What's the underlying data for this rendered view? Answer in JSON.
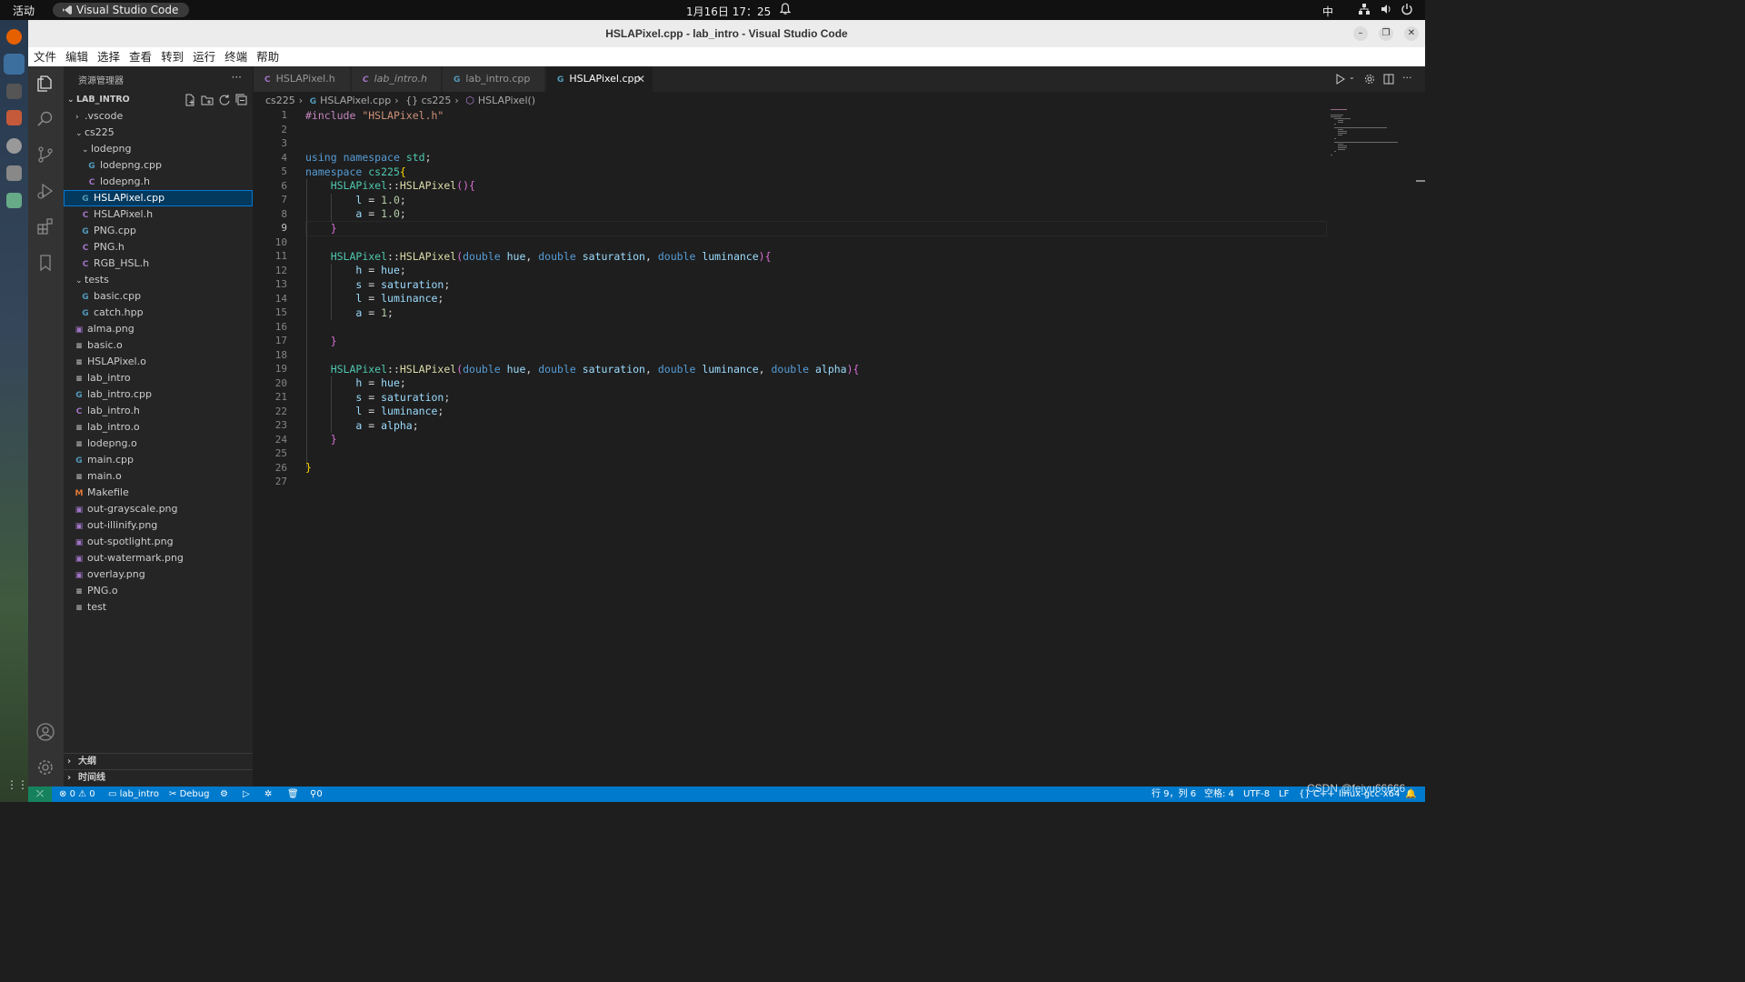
{
  "system": {
    "activities": "活动",
    "app_name": "Visual Studio Code",
    "clock": "1月16日 17：25",
    "input_method": "中"
  },
  "window": {
    "title": "HSLAPixel.cpp - lab_intro - Visual Studio Code"
  },
  "menu": [
    "文件",
    "编辑",
    "选择",
    "查看",
    "转到",
    "运行",
    "终端",
    "帮助"
  ],
  "sidebar": {
    "header": "资源管理器",
    "more": "···",
    "root": "LAB_INTRO",
    "tree": [
      {
        "label": ".vscode",
        "kind": "folder",
        "open": false,
        "depth": 1
      },
      {
        "label": "cs225",
        "kind": "folder",
        "open": true,
        "depth": 1
      },
      {
        "label": "lodepng",
        "kind": "folder",
        "open": true,
        "depth": 2
      },
      {
        "label": "lodepng.cpp",
        "kind": "cpp",
        "depth": 3
      },
      {
        "label": "lodepng.h",
        "kind": "h",
        "depth": 3
      },
      {
        "label": "HSLAPixel.cpp",
        "kind": "cpp",
        "depth": 2,
        "selected": true
      },
      {
        "label": "HSLAPixel.h",
        "kind": "h",
        "depth": 2
      },
      {
        "label": "PNG.cpp",
        "kind": "cpp",
        "depth": 2
      },
      {
        "label": "PNG.h",
        "kind": "h",
        "depth": 2
      },
      {
        "label": "RGB_HSL.h",
        "kind": "h",
        "depth": 2
      },
      {
        "label": "tests",
        "kind": "folder",
        "open": true,
        "depth": 1
      },
      {
        "label": "basic.cpp",
        "kind": "cpp",
        "depth": 2
      },
      {
        "label": "catch.hpp",
        "kind": "cpp",
        "depth": 2
      },
      {
        "label": "alma.png",
        "kind": "png",
        "depth": 1
      },
      {
        "label": "basic.o",
        "kind": "o",
        "depth": 1
      },
      {
        "label": "HSLAPixel.o",
        "kind": "o",
        "depth": 1
      },
      {
        "label": "lab_intro",
        "kind": "o",
        "depth": 1
      },
      {
        "label": "lab_intro.cpp",
        "kind": "cpp",
        "depth": 1
      },
      {
        "label": "lab_intro.h",
        "kind": "h",
        "depth": 1
      },
      {
        "label": "lab_intro.o",
        "kind": "o",
        "depth": 1
      },
      {
        "label": "lodepng.o",
        "kind": "o",
        "depth": 1
      },
      {
        "label": "main.cpp",
        "kind": "cpp",
        "depth": 1
      },
      {
        "label": "main.o",
        "kind": "o",
        "depth": 1
      },
      {
        "label": "Makefile",
        "kind": "mk",
        "depth": 1
      },
      {
        "label": "out-grayscale.png",
        "kind": "png",
        "depth": 1
      },
      {
        "label": "out-illinify.png",
        "kind": "png",
        "depth": 1
      },
      {
        "label": "out-spotlight.png",
        "kind": "png",
        "depth": 1
      },
      {
        "label": "out-watermark.png",
        "kind": "png",
        "depth": 1
      },
      {
        "label": "overlay.png",
        "kind": "png",
        "depth": 1
      },
      {
        "label": "PNG.o",
        "kind": "o",
        "depth": 1
      },
      {
        "label": "test",
        "kind": "o",
        "depth": 1
      }
    ],
    "outline": "大纲",
    "timeline": "时间线"
  },
  "tabs": [
    {
      "label": "HSLAPixel.h",
      "kind": "h",
      "active": false,
      "italic": false
    },
    {
      "label": "lab_intro.h",
      "kind": "h",
      "active": false,
      "italic": true
    },
    {
      "label": "lab_intro.cpp",
      "kind": "cpp",
      "active": false,
      "italic": false
    },
    {
      "label": "HSLAPixel.cpp",
      "kind": "cpp",
      "active": true,
      "italic": false
    }
  ],
  "breadcrumb": [
    "cs225",
    "HSLAPixel.cpp",
    "{} cs225",
    "HSLAPixel()"
  ],
  "editor": {
    "current_line": 9,
    "line_count": 27
  },
  "statusbar": {
    "errors": "0",
    "warnings": "0",
    "folder": "lab_intro",
    "debug": "Debug",
    "ports": "0",
    "position": "行 9，列 6",
    "spaces": "空格: 4",
    "encoding": "UTF-8",
    "eol": "LF",
    "language": "C++",
    "config": "linux-gcc-x64"
  },
  "watermark": "CSDN @feiyu66666",
  "colors": {
    "statusbar": "#007acc",
    "selection": "#04395e",
    "editor_bg": "#1e1e1e"
  }
}
